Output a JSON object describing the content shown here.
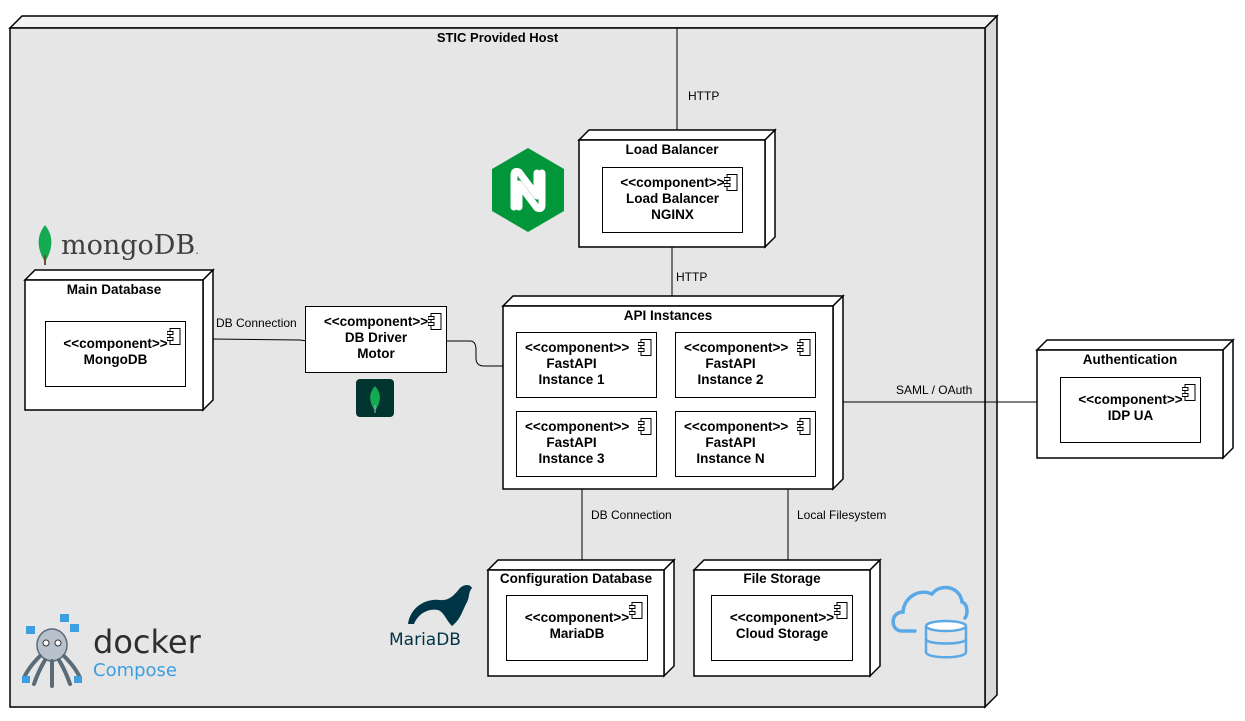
{
  "host": {
    "title": "STIC Provided Host"
  },
  "nodes": {
    "load_balancer": {
      "title": "Load Balancer",
      "component": {
        "stereotype": "<<component>>",
        "name_line1": "Load Balancer",
        "name_line2": "NGINX"
      }
    },
    "main_database": {
      "title": "Main Database",
      "component": {
        "stereotype": "<<component>>",
        "name_line1": "MongoDB"
      }
    },
    "db_driver": {
      "stereotype": "<<component>>",
      "name_line1": "DB Driver",
      "name_line2": "Motor"
    },
    "api_instances": {
      "title": "API Instances",
      "instances": [
        {
          "stereotype": "<<component>>",
          "name_line1": "FastAPI",
          "name_line2": "Instance 1"
        },
        {
          "stereotype": "<<component>>",
          "name_line1": "FastAPI",
          "name_line2": "Instance 2"
        },
        {
          "stereotype": "<<component>>",
          "name_line1": "FastAPI",
          "name_line2": "Instance 3"
        },
        {
          "stereotype": "<<component>>",
          "name_line1": "FastAPI",
          "name_line2": "Instance N"
        }
      ]
    },
    "authentication": {
      "title": "Authentication",
      "component": {
        "stereotype": "<<component>>",
        "name_line1": "IDP UA"
      }
    },
    "configuration_database": {
      "title": "Configuration Database",
      "component": {
        "stereotype": "<<component>>",
        "name_line1": "MariaDB"
      }
    },
    "file_storage": {
      "title": "File Storage",
      "component": {
        "stereotype": "<<component>>",
        "name_line1": "Cloud Storage"
      }
    }
  },
  "connections": {
    "http_top": "HTTP",
    "http_lb_api": "HTTP",
    "db_conn_mongo": "DB Connection",
    "db_conn_maria": "DB Connection",
    "local_fs": "Local Filesystem",
    "saml": "SAML / OAuth"
  },
  "logos": {
    "mongodb": {
      "text": "mongoDB",
      "mark": "."
    },
    "mariadb": {
      "text": "MariaDB"
    },
    "docker": {
      "line1": "docker",
      "line2": "Compose"
    }
  },
  "colors": {
    "nginx_green": "#009639",
    "fastapi_teal": "#009688",
    "mongo_green": "#13aa52",
    "mongo_dark": "#023430",
    "maria_navy": "#003545",
    "docker_text": "#2e2e2e",
    "compose_blue": "#3d9fe0",
    "cloud_blue": "#5aa9e6",
    "host_fill": "#e6e6e6"
  },
  "icons": [
    "nginx-logo-icon",
    "mongodb-leaf-icon",
    "fastapi-icon",
    "mariadb-seal-icon",
    "docker-octopus-icon",
    "cloud-database-icon",
    "component-icon"
  ]
}
